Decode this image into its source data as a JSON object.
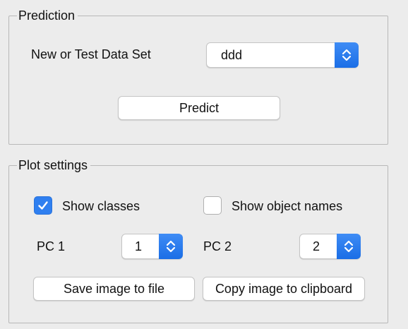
{
  "prediction": {
    "title": "Prediction",
    "dataset_label": "New or Test Data Set",
    "dataset_selected": "ddd",
    "predict_label": "Predict"
  },
  "plot_settings": {
    "title": "Plot settings",
    "show_classes_label": "Show classes",
    "show_classes_checked": true,
    "show_names_label": "Show object names",
    "show_names_checked": false,
    "pc1_label": "PC 1",
    "pc1_value": "1",
    "pc2_label": "PC 2",
    "pc2_value": "2",
    "save_label": "Save image to file",
    "copy_label": "Copy image to clipboard"
  },
  "colors": {
    "accent": "#2f7ff0",
    "panel_bg": "#ececec"
  },
  "icons": {
    "popup_arrows": "chevron-up-down-icon",
    "check": "checkmark-icon"
  }
}
